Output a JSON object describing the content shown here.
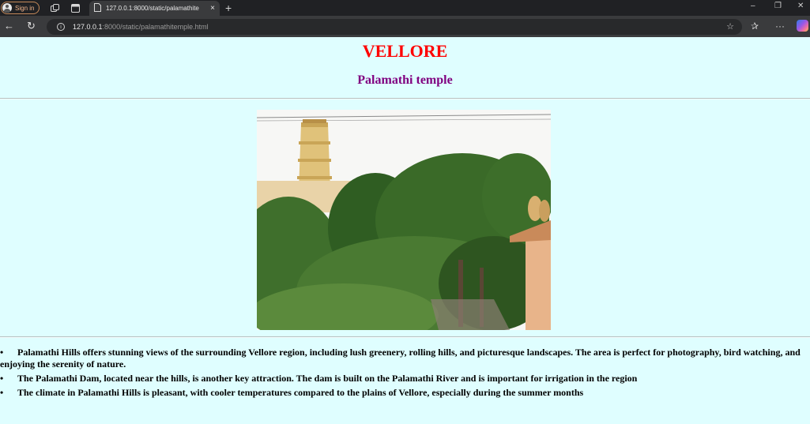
{
  "browser": {
    "sign_in_label": "Sign in",
    "tab_title": "127.0.0.1:8000/static/palamathite",
    "tab_close": "×",
    "new_tab": "+",
    "url_host": "127.0.0.1",
    "url_rest": ":8000/static/palamathitemple.html",
    "window_controls": {
      "minimize": "–",
      "restore": "❐",
      "close": "✕"
    },
    "nav": {
      "back": "←",
      "reload": "↻"
    },
    "more_label": "···"
  },
  "page": {
    "city_title": "VELLORE",
    "temple_title": "Palamathi temple",
    "photo_icon": "temple-photo",
    "facts": [
      "Palamathi Hills offers stunning views of the surrounding Vellore region, including lush greenery, rolling hills, and picturesque landscapes. The area is perfect for photography, bird watching, and enjoying the serenity of nature.",
      "The Palamathi Dam, located near the hills, is another key attraction. The dam is built on the Palamathi River and is important for irrigation in the region",
      "The climate in Palamathi Hills is pleasant, with cooler temperatures compared to the plains of Vellore, especially during the summer months"
    ]
  },
  "colors": {
    "page_background": "#dffeff",
    "city_title": "#ff0000",
    "temple_title": "#800080",
    "chrome_dark": "#202124",
    "chrome_bar": "#3a3b3d"
  }
}
